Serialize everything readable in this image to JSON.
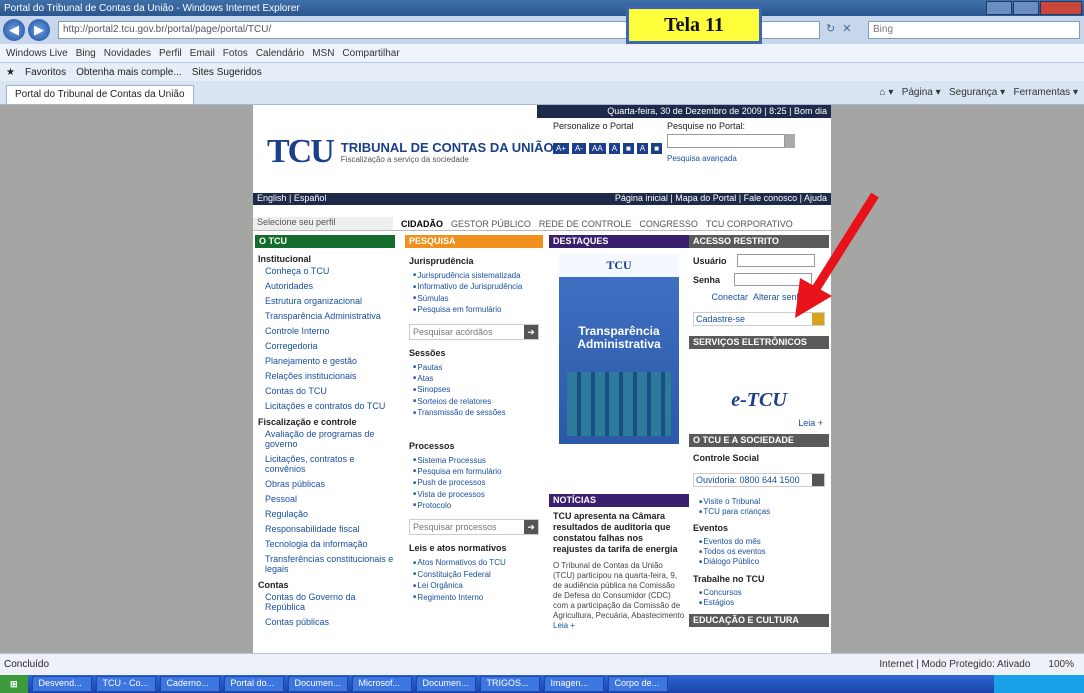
{
  "browser": {
    "window_title": "Portal do Tribunal de Contas da União - Windows Internet Explorer",
    "address": "http://portal2.tcu.gov.br/portal/page/portal/TCU/",
    "address_domain": "tcu.gov.br",
    "search_placeholder": "Bing",
    "links_bar": [
      "Windows Live",
      "Bing",
      "Novidades",
      "Perfil",
      "Email",
      "Fotos",
      "Calendário",
      "MSN",
      "Compartilhar"
    ],
    "favorites_label": "Favoritos",
    "favorites_items": [
      "Obtenha mais comple...",
      "Sites Sugeridos"
    ],
    "tab_title": "Portal do Tribunal de Contas da União",
    "command_items": [
      "Página",
      "Segurança",
      "Ferramentas"
    ],
    "status_left": "Concluído",
    "status_zone": "Internet | Modo Protegido: Ativado",
    "zoom": "100%"
  },
  "overlay": {
    "label": "Tela 11",
    "arrow_color": "#e8121a"
  },
  "site": {
    "date_line": "Quarta-feira, 30 de Dezembro de 2009 | 8:25 | Bom dia",
    "logo_text": "TCU",
    "org_name": "TRIBUNAL DE CONTAS DA UNIÃO",
    "org_slogan": "Fiscalização a serviço da sociedade",
    "personalize_label": "Personalize o Portal",
    "font_buttons": [
      "A+",
      "A-",
      "AA",
      "A",
      "■",
      "A",
      "■"
    ],
    "search_label": "Pesquise no Portal:",
    "search_advanced": "Pesquisa avançada",
    "lang": "English | Español",
    "top_links": "Página inicial | Mapa do Portal | Fale conosco | Ajuda",
    "profile_select": "Selecione seu perfil",
    "profile_tabs": [
      "CIDADÃO",
      "GESTOR PÚBLICO",
      "REDE DE CONTROLE",
      "CONGRESSO",
      "TCU CORPORATIVO"
    ],
    "col_otcu": {
      "header": "O TCU",
      "groups": [
        {
          "title": "Institucional",
          "links": [
            "Conheça o TCU",
            "Autoridades",
            "Estrutura organizacional",
            "Transparência Administrativa",
            "Controle Interno",
            "Corregedoria",
            "Planejamento e gestão",
            "Relações institucionais",
            "Contas do TCU",
            "Licitações e contratos do TCU"
          ]
        },
        {
          "title": "Fiscalização e controle",
          "links": [
            "Avaliação de programas de governo",
            "Licitações, contratos e convênios",
            "Obras públicas",
            "Pessoal",
            "Regulação",
            "Responsabilidade fiscal",
            "Tecnologia da informação",
            "Transferências constitucionais e legais"
          ]
        },
        {
          "title": "Contas",
          "links": [
            "Contas do Governo da República",
            "Contas públicas"
          ]
        }
      ]
    },
    "col_pesquisa": {
      "header": "PESQUISA",
      "juris_title": "Jurisprudência",
      "juris_links": [
        "Jurisprudência sistematizada",
        "Informativo de Jurisprudência",
        "Súmulas",
        "Pesquisa em formulário"
      ],
      "juris_search": "Pesquisar acórdãos",
      "sessoes_title": "Sessões",
      "sessoes_links": [
        "Pautas",
        "Atas",
        "Sinopses",
        "Sorteios de relatores",
        "Transmissão de sessões"
      ],
      "processos_title": "Processos",
      "processos_links": [
        "Sistema Processus",
        "Pesquisa em formulário",
        "Push de processos",
        "Vista de processos",
        "Protocolo"
      ],
      "processos_search": "Pesquisar processos",
      "leis_title": "Leis e atos normativos",
      "leis_links": [
        "Atos Normativos do TCU",
        "Constituição Federal",
        "Lei Orgânica",
        "Regimento Interno"
      ]
    },
    "col_destaques": {
      "header": "DESTAQUES",
      "banner_logo": "TCU",
      "banner_text": "Transparência Administrativa",
      "news_header": "NOTÍCIAS",
      "news_title": "TCU apresenta na Câmara resultados de auditoria que constatou falhas nos reajustes da tarifa de energia",
      "news_body": "O Tribunal de Contas da União (TCU) participou na quarta-feira, 9, de audiência pública na Comissão de Defesa do Consumidor (CDC) com a participação da Comissão de Agricultura, Pecuária, Abastecimento",
      "news_more": "Leia +"
    },
    "col_acesso": {
      "header": "ACESSO RESTRITO",
      "user_label": "Usuário",
      "pass_label": "Senha",
      "connect": "Conectar",
      "change_pass": "Alterar senha",
      "register": "Cadastre-se",
      "services_header": "SERVIÇOS ELETRÔNICOS",
      "etcu": "e-TCU",
      "leia": "Leia +",
      "society_header": "O TCU E A SOCIEDADE",
      "social_title": "Controle Social",
      "ouvidoria": "Ouvidoria: 0800 644 1500",
      "social_links": [
        "Visite o Tribunal",
        "TCU para crianças"
      ],
      "events_title": "Eventos",
      "events_links": [
        "Eventos do mês",
        "Todos os eventos",
        "Diálogo Público"
      ],
      "work_title": "Trabalhe no TCU",
      "work_links": [
        "Concursos",
        "Estágios"
      ],
      "culture_header": "EDUCAÇÃO E CULTURA"
    }
  },
  "taskbar": [
    "Desvend...",
    "TCU - Co...",
    "Caderno...",
    "Portal do...",
    "Documen...",
    "Microsof...",
    "Documen...",
    "TRIGOS...",
    "Imagen...",
    "Corpo de..."
  ]
}
